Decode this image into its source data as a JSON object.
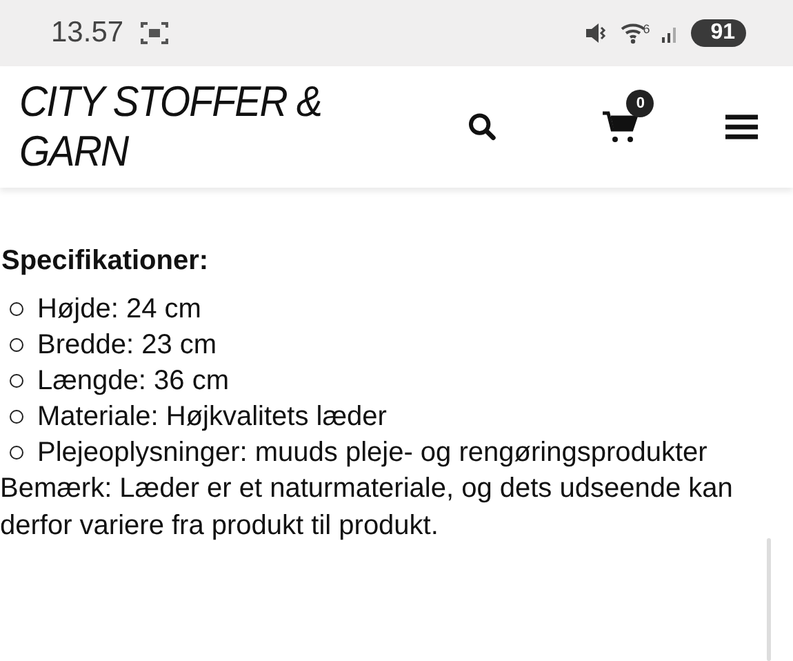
{
  "status_bar": {
    "time": "13.57",
    "wifi_label": "6",
    "battery": "91"
  },
  "header": {
    "logo": "CITY STOFFER & GARN",
    "cart_count": "0"
  },
  "specs": {
    "heading": "Specifikationer:",
    "items": [
      "Højde: 24 cm",
      "Bredde: 23 cm",
      "Længde: 36 cm",
      "Materiale: Højkvalitets læder",
      "Plejeoplysninger: muuds pleje- og rengøringsprodukter"
    ],
    "note": "Bemærk:  Læder er et naturmateriale, og dets udseende kan derfor variere fra produkt til produkt."
  }
}
